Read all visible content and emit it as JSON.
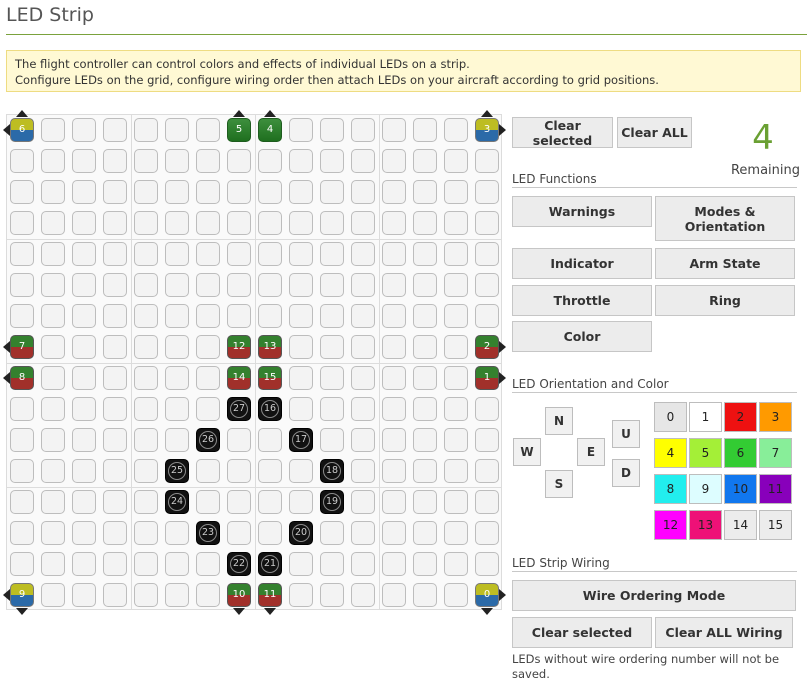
{
  "page": {
    "title": "LED Strip",
    "info_lines": [
      "The flight controller can control colors and effects of individual LEDs on a strip.",
      "Configure LEDs on the grid, configure wiring order then attach LEDs on your aircraft according to grid positions."
    ]
  },
  "grid": {
    "size": 16,
    "leds": [
      {
        "col": 0,
        "row": 0,
        "label": "6",
        "style": "gy",
        "arrows": [
          "up",
          "left"
        ]
      },
      {
        "col": 7,
        "row": 0,
        "label": "5",
        "style": "green",
        "arrows": [
          "up"
        ]
      },
      {
        "col": 8,
        "row": 0,
        "label": "4",
        "style": "green",
        "arrows": [
          "up"
        ]
      },
      {
        "col": 15,
        "row": 0,
        "label": "3",
        "style": "gy",
        "arrows": [
          "up",
          "right"
        ]
      },
      {
        "col": 0,
        "row": 7,
        "label": "7",
        "style": "gr",
        "arrows": [
          "left"
        ]
      },
      {
        "col": 7,
        "row": 7,
        "label": "12",
        "style": "gr",
        "arrows": []
      },
      {
        "col": 8,
        "row": 7,
        "label": "13",
        "style": "gr",
        "arrows": []
      },
      {
        "col": 15,
        "row": 7,
        "label": "2",
        "style": "gr",
        "arrows": [
          "right"
        ]
      },
      {
        "col": 0,
        "row": 8,
        "label": "8",
        "style": "gr",
        "arrows": [
          "left"
        ]
      },
      {
        "col": 7,
        "row": 8,
        "label": "14",
        "style": "gr",
        "arrows": []
      },
      {
        "col": 8,
        "row": 8,
        "label": "15",
        "style": "gr",
        "arrows": []
      },
      {
        "col": 15,
        "row": 8,
        "label": "1",
        "style": "gr",
        "arrows": [
          "right"
        ]
      },
      {
        "col": 7,
        "row": 9,
        "label": "27",
        "style": "wire",
        "arrows": []
      },
      {
        "col": 8,
        "row": 9,
        "label": "16",
        "style": "wire",
        "arrows": []
      },
      {
        "col": 6,
        "row": 10,
        "label": "26",
        "style": "wire",
        "arrows": []
      },
      {
        "col": 9,
        "row": 10,
        "label": "17",
        "style": "wire",
        "arrows": []
      },
      {
        "col": 5,
        "row": 11,
        "label": "25",
        "style": "wire",
        "arrows": []
      },
      {
        "col": 10,
        "row": 11,
        "label": "18",
        "style": "wire",
        "arrows": []
      },
      {
        "col": 5,
        "row": 12,
        "label": "24",
        "style": "wire",
        "arrows": []
      },
      {
        "col": 10,
        "row": 12,
        "label": "19",
        "style": "wire",
        "arrows": []
      },
      {
        "col": 6,
        "row": 13,
        "label": "23",
        "style": "wire",
        "arrows": []
      },
      {
        "col": 9,
        "row": 13,
        "label": "20",
        "style": "wire",
        "arrows": []
      },
      {
        "col": 7,
        "row": 14,
        "label": "22",
        "style": "wire",
        "arrows": []
      },
      {
        "col": 8,
        "row": 14,
        "label": "21",
        "style": "wire",
        "arrows": []
      },
      {
        "col": 0,
        "row": 15,
        "label": "9",
        "style": "gy",
        "arrows": [
          "down",
          "left"
        ]
      },
      {
        "col": 7,
        "row": 15,
        "label": "10",
        "style": "gr",
        "arrows": [
          "down"
        ]
      },
      {
        "col": 8,
        "row": 15,
        "label": "11",
        "style": "gr",
        "arrows": [
          "down"
        ]
      },
      {
        "col": 15,
        "row": 15,
        "label": "0",
        "style": "gy",
        "arrows": [
          "down",
          "right"
        ]
      }
    ]
  },
  "toolbar": {
    "clear_selected": "Clear selected",
    "clear_all": "Clear ALL"
  },
  "remaining": {
    "count": "4",
    "label": "Remaining"
  },
  "functions": {
    "label": "LED Functions",
    "warnings": "Warnings",
    "modes_line1": "Modes &",
    "modes_line2": "Orientation",
    "indicator": "Indicator",
    "arm_state": "Arm State",
    "throttle": "Throttle",
    "ring": "Ring",
    "color": "Color"
  },
  "orientation": {
    "label": "LED Orientation and Color",
    "n": "N",
    "w": "W",
    "e": "E",
    "s": "S",
    "u": "U",
    "d": "D"
  },
  "colors": [
    {
      "label": "0",
      "bg": "#e6e6e6"
    },
    {
      "label": "1",
      "bg": "#ffffff"
    },
    {
      "label": "2",
      "bg": "#ee1111"
    },
    {
      "label": "3",
      "bg": "#ff9a00"
    },
    {
      "label": "4",
      "bg": "#ffff00"
    },
    {
      "label": "5",
      "bg": "#a4ef37"
    },
    {
      "label": "6",
      "bg": "#33cc33"
    },
    {
      "label": "7",
      "bg": "#88ee99"
    },
    {
      "label": "8",
      "bg": "#22eeee"
    },
    {
      "label": "9",
      "bg": "#ddfdff"
    },
    {
      "label": "10",
      "bg": "#1177ee"
    },
    {
      "label": "11",
      "bg": "#8800bb"
    },
    {
      "label": "12",
      "bg": "#ff00ff"
    },
    {
      "label": "13",
      "bg": "#ee1177"
    },
    {
      "label": "14",
      "bg": "#ececec"
    },
    {
      "label": "15",
      "bg": "#ececec"
    }
  ],
  "wiring": {
    "label": "LED Strip Wiring",
    "mode_button": "Wire Ordering Mode",
    "clear_selected": "Clear selected",
    "clear_all": "Clear ALL Wiring",
    "note": "LEDs without wire ordering number will not be saved."
  }
}
